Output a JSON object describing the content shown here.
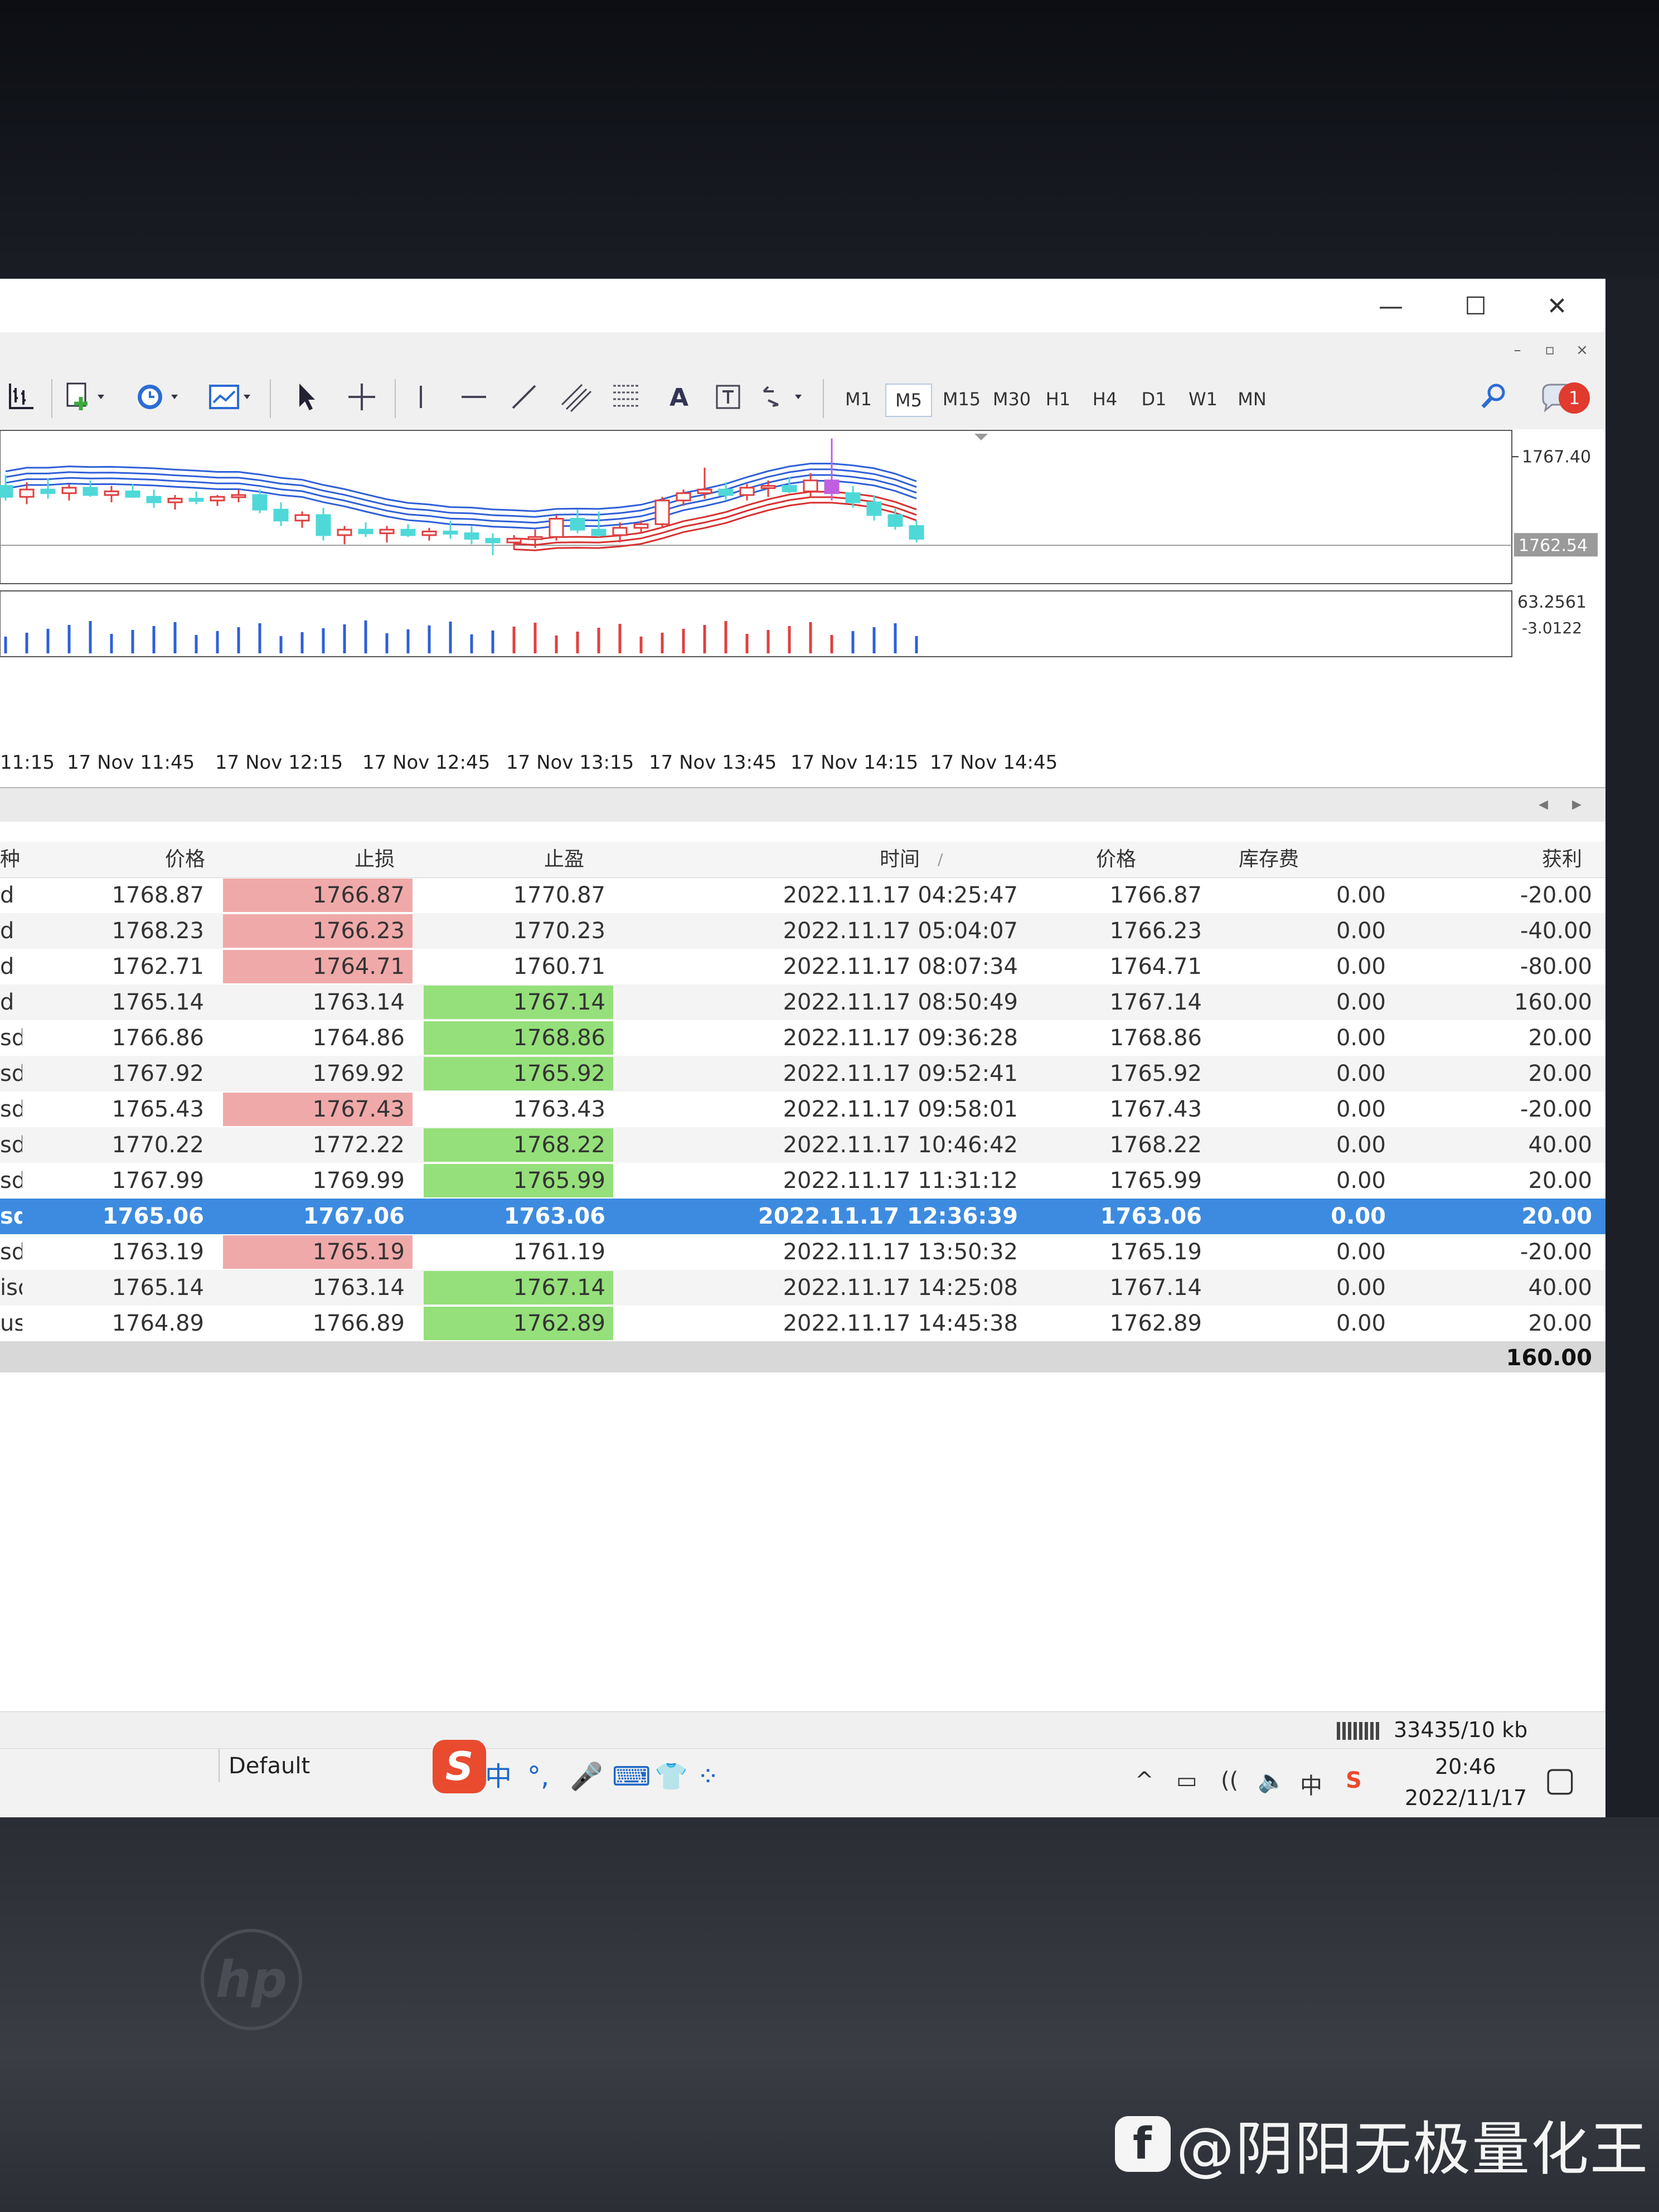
{
  "window": {
    "minimize": "—",
    "maximize": "☐",
    "close": "✕"
  },
  "mdi": {
    "minimize": "–",
    "restore": "▫",
    "close": "×"
  },
  "toolbar": {
    "timeframes": [
      "M1",
      "M5",
      "M15",
      "M30",
      "H1",
      "H4",
      "D1",
      "W1",
      "MN"
    ],
    "active_timeframe": "M5",
    "text_tool": "A",
    "notification_count": "1"
  },
  "chart_data": {
    "type": "candlestick",
    "title": "",
    "price_labels": [
      "1767.40",
      "1762.54"
    ],
    "current_price": 1762.54,
    "ylim": [
      1760.5,
      1768.6
    ],
    "indicator_labels": [
      "63.2561",
      "-3.0122"
    ],
    "time_labels": [
      "11:15",
      "17 Nov 11:45",
      "17 Nov 12:15",
      "17 Nov 12:45",
      "17 Nov 13:15",
      "17 Nov 13:45",
      "17 Nov 14:15",
      "17 Nov 14:45"
    ],
    "colors": {
      "up": "#e04040",
      "down": "#4fd8d8",
      "ma_upper": "#2f5fd8",
      "ma_lower": "#d83030",
      "vol_up": "#e04040",
      "vol_down": "#2f5fd8"
    },
    "candles": [
      {
        "o": 1765.8,
        "h": 1766.4,
        "l": 1765.0,
        "c": 1765.2
      },
      {
        "o": 1765.2,
        "h": 1766.0,
        "l": 1764.8,
        "c": 1765.6
      },
      {
        "o": 1765.6,
        "h": 1766.2,
        "l": 1765.1,
        "c": 1765.4
      },
      {
        "o": 1765.4,
        "h": 1765.9,
        "l": 1765.0,
        "c": 1765.7
      },
      {
        "o": 1765.7,
        "h": 1766.1,
        "l": 1765.2,
        "c": 1765.3
      },
      {
        "o": 1765.3,
        "h": 1765.8,
        "l": 1764.9,
        "c": 1765.5
      },
      {
        "o": 1765.5,
        "h": 1765.9,
        "l": 1765.2,
        "c": 1765.2
      },
      {
        "o": 1765.2,
        "h": 1765.6,
        "l": 1764.6,
        "c": 1764.9
      },
      {
        "o": 1764.9,
        "h": 1765.3,
        "l": 1764.5,
        "c": 1765.1
      },
      {
        "o": 1765.1,
        "h": 1765.5,
        "l": 1764.8,
        "c": 1765.0
      },
      {
        "o": 1765.0,
        "h": 1765.3,
        "l": 1764.7,
        "c": 1765.2
      },
      {
        "o": 1765.2,
        "h": 1765.6,
        "l": 1764.9,
        "c": 1765.3
      },
      {
        "o": 1765.3,
        "h": 1765.6,
        "l": 1764.3,
        "c": 1764.5
      },
      {
        "o": 1764.5,
        "h": 1764.9,
        "l": 1763.6,
        "c": 1763.9
      },
      {
        "o": 1763.9,
        "h": 1764.4,
        "l": 1763.5,
        "c": 1764.2
      },
      {
        "o": 1764.2,
        "h": 1764.6,
        "l": 1762.8,
        "c": 1763.1
      },
      {
        "o": 1763.1,
        "h": 1763.6,
        "l": 1762.6,
        "c": 1763.4
      },
      {
        "o": 1763.4,
        "h": 1763.8,
        "l": 1763.0,
        "c": 1763.2
      },
      {
        "o": 1763.2,
        "h": 1763.6,
        "l": 1762.7,
        "c": 1763.4
      },
      {
        "o": 1763.4,
        "h": 1763.7,
        "l": 1763.0,
        "c": 1763.1
      },
      {
        "o": 1763.1,
        "h": 1763.5,
        "l": 1762.8,
        "c": 1763.3
      },
      {
        "o": 1763.3,
        "h": 1763.9,
        "l": 1762.9,
        "c": 1763.2
      },
      {
        "o": 1763.2,
        "h": 1763.6,
        "l": 1762.6,
        "c": 1762.9
      },
      {
        "o": 1762.9,
        "h": 1763.2,
        "l": 1762.0,
        "c": 1762.7
      },
      {
        "o": 1762.7,
        "h": 1763.1,
        "l": 1762.3,
        "c": 1762.9
      },
      {
        "o": 1762.9,
        "h": 1763.4,
        "l": 1762.4,
        "c": 1763.0
      },
      {
        "o": 1763.0,
        "h": 1764.2,
        "l": 1762.8,
        "c": 1764.0
      },
      {
        "o": 1764.0,
        "h": 1764.5,
        "l": 1763.2,
        "c": 1763.4
      },
      {
        "o": 1763.4,
        "h": 1764.4,
        "l": 1763.0,
        "c": 1763.1
      },
      {
        "o": 1763.1,
        "h": 1763.8,
        "l": 1762.7,
        "c": 1763.5
      },
      {
        "o": 1763.5,
        "h": 1763.9,
        "l": 1763.2,
        "c": 1763.7
      },
      {
        "o": 1763.7,
        "h": 1765.2,
        "l": 1763.5,
        "c": 1765.0
      },
      {
        "o": 1765.0,
        "h": 1765.6,
        "l": 1764.7,
        "c": 1765.4
      },
      {
        "o": 1765.4,
        "h": 1766.8,
        "l": 1765.1,
        "c": 1765.6
      },
      {
        "o": 1765.6,
        "h": 1766.0,
        "l": 1765.0,
        "c": 1765.3
      },
      {
        "o": 1765.3,
        "h": 1765.9,
        "l": 1765.0,
        "c": 1765.7
      },
      {
        "o": 1765.7,
        "h": 1766.1,
        "l": 1765.2,
        "c": 1765.8
      },
      {
        "o": 1765.8,
        "h": 1766.3,
        "l": 1765.4,
        "c": 1765.5
      },
      {
        "o": 1765.5,
        "h": 1766.5,
        "l": 1765.2,
        "c": 1766.1
      },
      {
        "o": 1766.1,
        "h": 1768.4,
        "l": 1765.0,
        "c": 1765.4
      },
      {
        "o": 1765.4,
        "h": 1765.8,
        "l": 1764.6,
        "c": 1764.9
      },
      {
        "o": 1764.9,
        "h": 1765.3,
        "l": 1763.9,
        "c": 1764.2
      },
      {
        "o": 1764.2,
        "h": 1764.6,
        "l": 1763.4,
        "c": 1763.6
      },
      {
        "o": 1763.6,
        "h": 1763.9,
        "l": 1762.7,
        "c": 1762.9
      }
    ],
    "volumes": [
      1,
      0,
      1,
      1,
      0,
      1,
      0,
      1,
      1,
      0,
      1,
      1,
      1,
      0,
      1,
      1,
      0,
      1,
      1,
      1,
      0,
      1,
      1,
      0,
      1,
      1,
      1,
      1,
      0,
      1,
      0,
      1,
      1,
      1,
      1,
      1,
      1,
      1,
      1,
      1,
      0,
      0,
      0,
      0
    ]
  },
  "terminal": {
    "nav_left": "◂",
    "nav_right": "▸",
    "columns": {
      "symbol": "种",
      "price": "价格",
      "sl": "止损",
      "tp": "止盈",
      "time": "时间",
      "sort_mark": "/",
      "close_price": "价格",
      "swap": "库存费",
      "profit": "获利"
    },
    "rows": [
      {
        "sym": "d",
        "price": "1768.87",
        "sl": "1766.87",
        "sl_c": "red",
        "tp": "1770.87",
        "tp_c": "",
        "time": "2022.11.17 04:25:47",
        "cp": "1766.87",
        "swap": "0.00",
        "profit": "-20.00"
      },
      {
        "sym": "d",
        "price": "1768.23",
        "sl": "1766.23",
        "sl_c": "red",
        "tp": "1770.23",
        "tp_c": "",
        "time": "2022.11.17 05:04:07",
        "cp": "1766.23",
        "swap": "0.00",
        "profit": "-40.00"
      },
      {
        "sym": "d",
        "price": "1762.71",
        "sl": "1764.71",
        "sl_c": "red",
        "tp": "1760.71",
        "tp_c": "",
        "time": "2022.11.17 08:07:34",
        "cp": "1764.71",
        "swap": "0.00",
        "profit": "-80.00"
      },
      {
        "sym": "d",
        "price": "1765.14",
        "sl": "1763.14",
        "sl_c": "",
        "tp": "1767.14",
        "tp_c": "green",
        "time": "2022.11.17 08:50:49",
        "cp": "1767.14",
        "swap": "0.00",
        "profit": "160.00"
      },
      {
        "sym": "sd",
        "price": "1766.86",
        "sl": "1764.86",
        "sl_c": "",
        "tp": "1768.86",
        "tp_c": "green",
        "time": "2022.11.17 09:36:28",
        "cp": "1768.86",
        "swap": "0.00",
        "profit": "20.00"
      },
      {
        "sym": "sd",
        "price": "1767.92",
        "sl": "1769.92",
        "sl_c": "",
        "tp": "1765.92",
        "tp_c": "green",
        "time": "2022.11.17 09:52:41",
        "cp": "1765.92",
        "swap": "0.00",
        "profit": "20.00"
      },
      {
        "sym": "sd",
        "price": "1765.43",
        "sl": "1767.43",
        "sl_c": "red",
        "tp": "1763.43",
        "tp_c": "",
        "time": "2022.11.17 09:58:01",
        "cp": "1767.43",
        "swap": "0.00",
        "profit": "-20.00"
      },
      {
        "sym": "sd",
        "price": "1770.22",
        "sl": "1772.22",
        "sl_c": "",
        "tp": "1768.22",
        "tp_c": "green",
        "time": "2022.11.17 10:46:42",
        "cp": "1768.22",
        "swap": "0.00",
        "profit": "40.00"
      },
      {
        "sym": "sd",
        "price": "1767.99",
        "sl": "1769.99",
        "sl_c": "",
        "tp": "1765.99",
        "tp_c": "green",
        "time": "2022.11.17 11:31:12",
        "cp": "1765.99",
        "swap": "0.00",
        "profit": "20.00"
      },
      {
        "sym": "sd",
        "price": "1765.06",
        "sl": "1767.06",
        "sl_c": "",
        "tp": "1763.06",
        "tp_c": "green",
        "time": "2022.11.17 12:36:39",
        "cp": "1763.06",
        "swap": "0.00",
        "profit": "20.00",
        "selected": true
      },
      {
        "sym": "sd",
        "price": "1763.19",
        "sl": "1765.19",
        "sl_c": "red",
        "tp": "1761.19",
        "tp_c": "",
        "time": "2022.11.17 13:50:32",
        "cp": "1765.19",
        "swap": "0.00",
        "profit": "-20.00"
      },
      {
        "sym": "isd",
        "price": "1765.14",
        "sl": "1763.14",
        "sl_c": "",
        "tp": "1767.14",
        "tp_c": "green",
        "time": "2022.11.17 14:25:08",
        "cp": "1767.14",
        "swap": "0.00",
        "profit": "40.00"
      },
      {
        "sym": "usd",
        "price": "1764.89",
        "sl": "1766.89",
        "sl_c": "",
        "tp": "1762.89",
        "tp_c": "green",
        "time": "2022.11.17 14:45:38",
        "cp": "1762.89",
        "swap": "0.00",
        "profit": "20.00"
      }
    ],
    "total_profit": "160.00"
  },
  "status": {
    "traffic": "33435/10 kb"
  },
  "taskbar": {
    "profile": "Default",
    "ime_logo": "S",
    "ime_items": [
      "中",
      "°,",
      "🎤",
      "⌨",
      "👕",
      "⁘"
    ],
    "tray_items": [
      "^",
      "▭",
      "((",
      "🔈",
      "中",
      "S"
    ],
    "time": "20:46",
    "date": "2022/11/17",
    "notify_icon": "▢"
  },
  "watermark": {
    "icon": "f",
    "text": "@阴阳无极量化王"
  }
}
